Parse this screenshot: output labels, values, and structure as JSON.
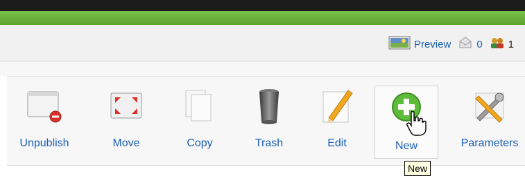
{
  "status_bar": {
    "preview_label": "Preview",
    "messages_count": "0",
    "users_online": "1"
  },
  "toolbar": {
    "buttons": [
      {
        "label": "Unpublish",
        "icon": "unpublish-icon"
      },
      {
        "label": "Move",
        "icon": "move-icon"
      },
      {
        "label": "Copy",
        "icon": "copy-icon"
      },
      {
        "label": "Trash",
        "icon": "trash-icon"
      },
      {
        "label": "Edit",
        "icon": "edit-icon"
      },
      {
        "label": "New",
        "icon": "new-icon"
      },
      {
        "label": "Parameters",
        "icon": "parameters-icon"
      }
    ]
  },
  "tooltip": {
    "text": "New"
  },
  "colors": {
    "accent_green": "#5aa52d",
    "link_blue": "#1a5fb4"
  }
}
